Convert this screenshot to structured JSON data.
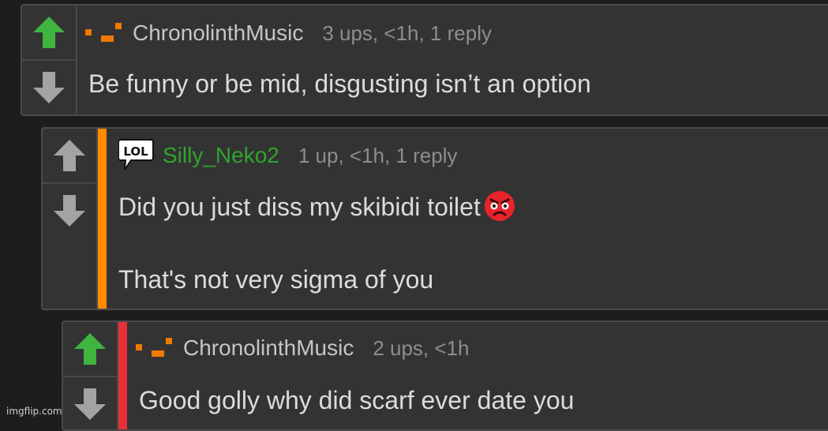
{
  "comments": [
    {
      "username": "ChronolinthMusic",
      "username_color": "#c6c6c6",
      "stats": "3 ups, <1h, 1 reply",
      "lines": [
        "Be funny or be mid, disgusting isn’t an option"
      ],
      "upvote_icon": "arrow-up-icon",
      "upvote_color": "#3fb43f",
      "downvote_icon": "arrow-down-icon",
      "flair_icon": "stair-blocks-icon",
      "flair_color": "#f07a00"
    },
    {
      "username": "Silly_Neko2",
      "username_color": "#2ea52e",
      "stats": "1 up, <1h, 1 reply",
      "lines": [
        "Did you just diss my skibidi toilet",
        "That's not very sigma of you"
      ],
      "thread_bar_color": "#ff8a00",
      "upvote_icon": "arrow-up-icon",
      "upvote_color": "#a3a3a3",
      "downvote_icon": "arrow-down-icon",
      "flair_icon": "lol-speech-bubble-icon",
      "flair_text": "LOL",
      "emoji_icon": "angry-face-emoji-icon"
    },
    {
      "username": "ChronolinthMusic",
      "username_color": "#c6c6c6",
      "stats": "2 ups, <1h",
      "lines": [
        "Good golly why did scarf ever date you"
      ],
      "thread_bar_color": "#e8303a",
      "upvote_icon": "arrow-up-icon",
      "upvote_color": "#3fb43f",
      "downvote_icon": "arrow-down-icon",
      "flair_icon": "stair-blocks-icon",
      "flair_color": "#f07a00"
    }
  ],
  "watermark": "imgflip.com"
}
